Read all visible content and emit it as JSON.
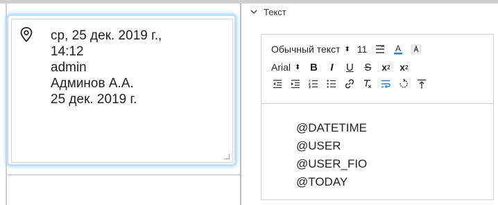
{
  "card": {
    "lines": [
      "ср, 25 дек. 2019 г.,",
      "14:12",
      "admin",
      "Админов А.А.",
      "25 дек. 2019 г."
    ]
  },
  "section": {
    "title": "Текст"
  },
  "toolbar": {
    "style_value": "Обычный текст",
    "size_value": "11",
    "font_value": "Arial",
    "bold_label": "B",
    "italic_label": "I",
    "underline_label": "U",
    "strike_label": "S",
    "subscript_label": "x",
    "subscript_mark": "2",
    "superscript_label": "x",
    "superscript_mark": "2",
    "font_color_label": "A",
    "updown_glyph": "⬍"
  },
  "editor": {
    "lines": [
      "@DATETIME",
      "@USER",
      "@USER_FIO",
      "@TODAY"
    ]
  },
  "colors": {
    "accent_blue": "#2a7fd4",
    "font_color_bar": "#2a7fd4",
    "glow": "#9fd0f6"
  }
}
